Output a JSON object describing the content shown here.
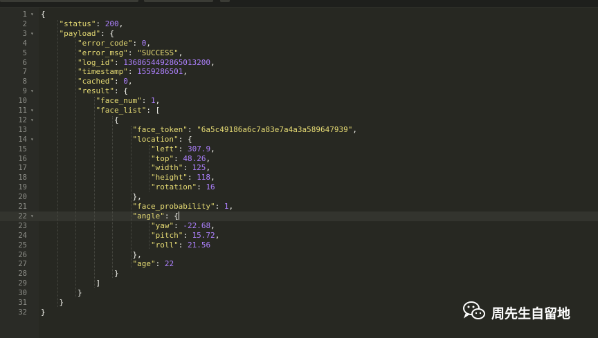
{
  "editor": {
    "lines": [
      {
        "num": "1",
        "fold": true,
        "code": "{"
      },
      {
        "num": "2",
        "code": "    \"status\": 200,"
      },
      {
        "num": "3",
        "fold": true,
        "code": "    \"payload\": {"
      },
      {
        "num": "4",
        "code": "        \"error_code\": 0,"
      },
      {
        "num": "5",
        "code": "        \"error_msg\": \"SUCCESS\","
      },
      {
        "num": "6",
        "code": "        \"log_id\": 1368654492865013200,"
      },
      {
        "num": "7",
        "code": "        \"timestamp\": 1559286501,"
      },
      {
        "num": "8",
        "code": "        \"cached\": 0,"
      },
      {
        "num": "9",
        "fold": true,
        "code": "        \"result\": {"
      },
      {
        "num": "10",
        "code": "            \"face_num\": 1,"
      },
      {
        "num": "11",
        "fold": true,
        "code": "            \"face_list\": ["
      },
      {
        "num": "12",
        "fold": true,
        "code": "                {"
      },
      {
        "num": "13",
        "code": "                    \"face_token\": \"6a5c49186a6c7a83e7a4a3a589647939\","
      },
      {
        "num": "14",
        "fold": true,
        "code": "                    \"location\": {"
      },
      {
        "num": "15",
        "code": "                        \"left\": 307.9,"
      },
      {
        "num": "16",
        "code": "                        \"top\": 48.26,"
      },
      {
        "num": "17",
        "code": "                        \"width\": 125,"
      },
      {
        "num": "18",
        "code": "                        \"height\": 118,"
      },
      {
        "num": "19",
        "code": "                        \"rotation\": 16"
      },
      {
        "num": "20",
        "code": "                    },"
      },
      {
        "num": "21",
        "code": "                    \"face_probability\": 1,"
      },
      {
        "num": "22",
        "fold": true,
        "active": true,
        "code": "                    \"angle\": {",
        "caret": true
      },
      {
        "num": "23",
        "code": "                        \"yaw\": -22.68,"
      },
      {
        "num": "24",
        "code": "                        \"pitch\": 15.72,"
      },
      {
        "num": "25",
        "code": "                        \"roll\": 21.56"
      },
      {
        "num": "26",
        "code": "                    },"
      },
      {
        "num": "27",
        "code": "                    \"age\": 22"
      },
      {
        "num": "28",
        "code": "                }"
      },
      {
        "num": "29",
        "code": "            ]"
      },
      {
        "num": "30",
        "code": "        }"
      },
      {
        "num": "31",
        "code": "    }"
      },
      {
        "num": "32",
        "code": "}"
      }
    ],
    "fold_arrow": "▾"
  },
  "watermark": {
    "icon": "wechat-icon",
    "text": "周先生自留地"
  },
  "colors": {
    "background": "#272822",
    "gutter": "#2a2b26",
    "key": "#e6db74",
    "string": "#e6db74",
    "number": "#ae81ff",
    "punctuation": "#f8f8f2",
    "line_number": "#8f908a"
  }
}
